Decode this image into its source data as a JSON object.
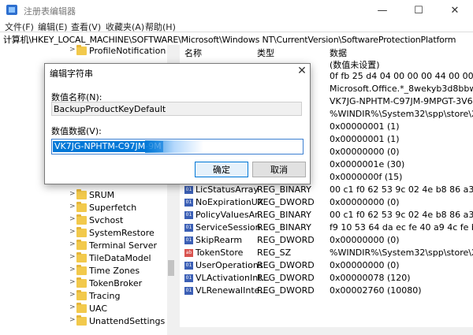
{
  "window": {
    "title": "注册表编辑器",
    "minimize": "—",
    "maximize": "☐",
    "close": "✕"
  },
  "menu": [
    "文件(F)",
    "编辑(E)",
    "查看(V)",
    "收藏夹(A)",
    "帮助(H)"
  ],
  "address": "计算机\\HKEY_LOCAL_MACHINE\\SOFTWARE\\Microsoft\\Windows NT\\CurrentVersion\\SoftwareProtectionPlatform",
  "tree": [
    {
      "label": "ProfileNotification"
    },
    {
      "label": "SRUM"
    },
    {
      "label": "Superfetch"
    },
    {
      "label": "Svchost"
    },
    {
      "label": "SystemRestore"
    },
    {
      "label": "Terminal Server"
    },
    {
      "label": "TileDataModel"
    },
    {
      "label": "Time Zones"
    },
    {
      "label": "TokenBroker"
    },
    {
      "label": "Tracing"
    },
    {
      "label": "UAC"
    },
    {
      "label": "UnattendSettings"
    }
  ],
  "list": {
    "headers": {
      "name": "名称",
      "type": "类型",
      "data": "数据"
    },
    "rows": [
      {
        "name": "",
        "type": "",
        "data": "(数值未设置)",
        "icon": "none"
      },
      {
        "name": "",
        "type": "",
        "data": "0f fb 25 d4 04 00 00 00 44 00 00 00 48",
        "icon": "none"
      },
      {
        "name": "",
        "type": "",
        "data": "Microsoft.Office.*_8wekyb3d8bbwe",
        "icon": "none"
      },
      {
        "name": "",
        "type": "",
        "data": "VK7JG-NPHTM-C97JM-9MPGT-3V66T",
        "icon": "none"
      },
      {
        "name": "",
        "type": "",
        "data": "%WINDIR%\\System32\\spp\\store\\2.0\\ca",
        "icon": "none"
      },
      {
        "name": "",
        "type": "",
        "data": "0x00000001 (1)",
        "icon": "none"
      },
      {
        "name": "",
        "type": "",
        "data": "0x00000001 (1)",
        "icon": "none"
      },
      {
        "name": "",
        "type": "",
        "data": "0x00000000 (0)",
        "icon": "none"
      },
      {
        "name": "",
        "type": "",
        "data": "0x0000001e (30)",
        "icon": "none"
      },
      {
        "name": "",
        "type": "",
        "data": "0x0000000f (15)",
        "icon": "none"
      },
      {
        "name": "LicStatusArray",
        "type": "REG_BINARY",
        "data": "00 c1 f0 62 53 9c 02 4e b8 86 a3 52 8d",
        "icon": "binary"
      },
      {
        "name": "NoExpirationUX",
        "type": "REG_DWORD",
        "data": "0x00000000 (0)",
        "icon": "binary"
      },
      {
        "name": "PolicyValuesAr...",
        "type": "REG_BINARY",
        "data": "00 c1 f0 62 53 9c 02 4e b8 86 a3 52 8d",
        "icon": "binary"
      },
      {
        "name": "ServiceSession...",
        "type": "REG_BINARY",
        "data": "f9 10 53 64 da ec fe 40 a9 4c fe b8 ad",
        "icon": "binary"
      },
      {
        "name": "SkipRearm",
        "type": "REG_DWORD",
        "data": "0x00000000 (0)",
        "icon": "binary"
      },
      {
        "name": "TokenStore",
        "type": "REG_SZ",
        "data": "%WINDIR%\\System32\\spp\\store\\2.0",
        "icon": "string"
      },
      {
        "name": "UserOperations",
        "type": "REG_DWORD",
        "data": "0x00000000 (0)",
        "icon": "binary"
      },
      {
        "name": "VLActivationInt...",
        "type": "REG_DWORD",
        "data": "0x00000078 (120)",
        "icon": "binary"
      },
      {
        "name": "VLRenewalInte...",
        "type": "REG_DWORD",
        "data": "0x00002760 (10080)",
        "icon": "binary"
      }
    ]
  },
  "dialog": {
    "title": "编辑字符串",
    "close": "✕",
    "name_label": "数值名称(N):",
    "name_value": "BackupProductKeyDefault",
    "data_label": "数值数据(V):",
    "data_value": "VK7JG-NPHTM-C97JM-9M",
    "ok": "确定",
    "cancel": "取消"
  },
  "colors": {
    "accent": "#0078d7",
    "folder": "#f2c94c"
  }
}
